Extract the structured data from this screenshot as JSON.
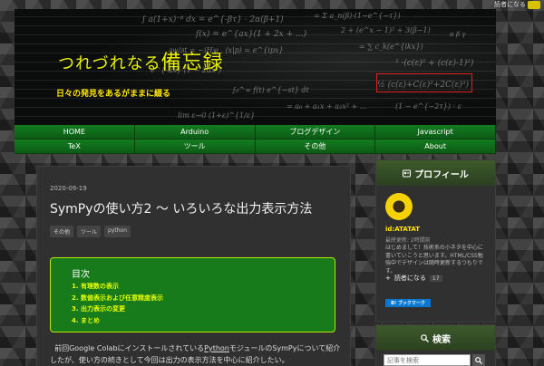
{
  "topbar": {
    "text": "読者になる"
  },
  "header": {
    "title_prefix": "つれづれなる",
    "title_main": "備忘録",
    "description": "日々の発見をあるがままに綴る"
  },
  "nav": [
    "HOME",
    "Arduino",
    "ブログデザイン",
    "Javascript",
    "TeX",
    "ツール",
    "その他",
    "About"
  ],
  "post": {
    "date": "2020-09-19",
    "title": "SymPyの使い方2 〜 いろいろな出力表示方法",
    "tags": [
      "その他",
      "ツール",
      "python"
    ],
    "toc_title": "目次",
    "toc_items": [
      "1. 有理数の表示",
      "2. 数値表示および任意精度表示",
      "3. 出力表示の変更",
      "4. まとめ"
    ],
    "body_line1_pre": "前回Google Colabにインストールされている",
    "body_line1_link": "Python",
    "body_line1_post": "モジュールのSymPyについて紹介",
    "body_line2": "したが、使い方の続きとして今回は出力の表示方法を中心に紹介したい。"
  },
  "profile": {
    "heading": "プロフィール",
    "user_id": "id:ATATAT",
    "last_updated": "最終更新: 2時間前",
    "text": "はじめまして！技術系の小ネタを中心に書いていこうと思います。HTML/CSS勉強中でデザインは随時更新するつもりです。",
    "subscribe_label": "読者になる",
    "subscribe_count": "17",
    "bookmark_label": "B! ブックマーク"
  },
  "search": {
    "heading": "検索",
    "placeholder": "記事を検索"
  },
  "colors": {
    "accent": "#e8f000",
    "nav_green": "#0e6a18",
    "toc_bg": "#177a1b"
  }
}
